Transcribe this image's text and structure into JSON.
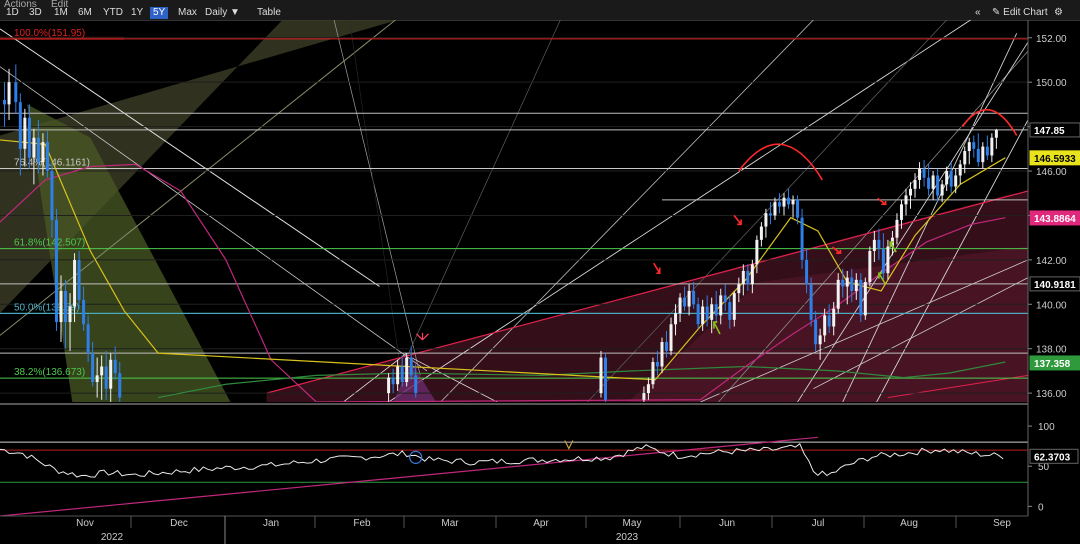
{
  "toolbar": {
    "menu_actions": "Actions",
    "menu_edit": "Edit",
    "ranges": [
      "1D",
      "3D",
      "1M",
      "6M",
      "YTD",
      "1Y",
      "5Y",
      "Max"
    ],
    "active_range": "5Y",
    "interval": "Daily",
    "interval_arrow": "▼",
    "table_label": "Table",
    "collapse_icon": "«",
    "edit_chart_label": "Edit Chart",
    "pencil_icon": "✎",
    "settings_icon": "⚙"
  },
  "colors": {
    "candle_up": "#f2f2f2",
    "candle_down": "#2f7fe8",
    "fib": "#4cc94c",
    "ma_fast": "#d8c21c",
    "ma_slow": "#c0287c",
    "ma_long": "#2f8a3c",
    "trend_channel": "#e0224c",
    "rsi": "#e8e8e8",
    "annot_red": "#ff2a2a",
    "annot_green": "#86c21c"
  },
  "chart_data": {
    "type": "candlestick",
    "months": [
      "Nov",
      "Dec",
      "Jan",
      "Feb",
      "Mar",
      "Apr",
      "May",
      "Jun",
      "Jul",
      "Aug",
      "Sep"
    ],
    "years": [
      "2022",
      "2023"
    ],
    "y_ticks": [
      136,
      138,
      140,
      142,
      144,
      146,
      148,
      150,
      152
    ],
    "y_range": [
      135.6,
      152.8
    ],
    "fib_levels": [
      {
        "label": "100.0%(151.95)",
        "value": 151.95
      },
      {
        "label": "76.4%(146.1161)",
        "value": 146.1161
      },
      {
        "label": "61.8%(142.507)",
        "value": 142.507
      },
      {
        "label": "50.0%(139.59)",
        "value": 139.59
      },
      {
        "label": "38.2%(136.673)",
        "value": 136.673
      }
    ],
    "horizontal_levels": [
      148.6,
      147.85,
      146.1161,
      144.7,
      140.9181,
      139.59,
      137.8
    ],
    "price_tags": [
      {
        "label": "147.85",
        "value": 147.85,
        "bg": "#000000",
        "fg": "#ffffff"
      },
      {
        "label": "146.5933",
        "value": 146.5933,
        "bg": "#e8e31c",
        "fg": "#000000"
      },
      {
        "label": "143.8864",
        "value": 143.8864,
        "bg": "#e0287c",
        "fg": "#ffffff"
      },
      {
        "label": "140.9181",
        "value": 140.9181,
        "bg": "#000000",
        "fg": "#ffffff"
      },
      {
        "label": "137.358",
        "value": 137.358,
        "bg": "#2f9a3c",
        "fg": "#ffffff"
      }
    ],
    "candles": [
      [
        0.2,
        149.2,
        150.0,
        148.0,
        149.0
      ],
      [
        0.4,
        149.0,
        150.6,
        148.3,
        150.0
      ],
      [
        0.7,
        150.0,
        150.8,
        148.6,
        149.1
      ],
      [
        0.9,
        149.1,
        149.5,
        145.8,
        147.0
      ],
      [
        1.1,
        147.0,
        148.8,
        146.2,
        148.4
      ],
      [
        1.3,
        148.4,
        149.0,
        146.1,
        146.6
      ],
      [
        1.5,
        146.6,
        147.9,
        145.4,
        147.5
      ],
      [
        1.7,
        147.5,
        148.3,
        145.9,
        146.4
      ],
      [
        1.9,
        146.4,
        147.7,
        145.8,
        147.3
      ],
      [
        2.1,
        147.3,
        147.8,
        145.7,
        146.0
      ],
      [
        2.3,
        146.0,
        146.4,
        143.0,
        143.8
      ],
      [
        2.5,
        143.8,
        144.3,
        138.8,
        139.2
      ],
      [
        2.7,
        139.2,
        141.3,
        138.3,
        140.6
      ],
      [
        2.9,
        140.6,
        141.1,
        138.0,
        139.2
      ],
      [
        3.1,
        139.2,
        140.5,
        137.9,
        139.9
      ],
      [
        3.3,
        139.9,
        142.3,
        139.2,
        142.0
      ],
      [
        3.5,
        142.0,
        142.4,
        139.8,
        140.2
      ],
      [
        3.7,
        140.2,
        140.8,
        138.8,
        139.1
      ],
      [
        3.9,
        139.1,
        139.5,
        137.4,
        137.8
      ],
      [
        4.1,
        137.8,
        138.3,
        136.3,
        136.5
      ],
      [
        4.3,
        136.5,
        137.6,
        135.8,
        136.8
      ],
      [
        4.5,
        136.8,
        137.7,
        135.7,
        137.2
      ],
      [
        4.7,
        137.2,
        137.9,
        135.7,
        136.2
      ],
      [
        4.9,
        136.2,
        137.8,
        135.6,
        137.5
      ],
      [
        5.1,
        137.5,
        138.1,
        136.6,
        136.9
      ],
      [
        5.3,
        136.9,
        137.4,
        135.6,
        135.8
      ],
      [
        17.2,
        136.0,
        136.9,
        135.6,
        136.7
      ],
      [
        17.4,
        136.7,
        137.1,
        136.0,
        136.4
      ],
      [
        17.6,
        136.4,
        137.5,
        136.1,
        137.2
      ],
      [
        17.8,
        137.2,
        137.7,
        136.3,
        136.5
      ],
      [
        18.0,
        136.5,
        137.8,
        136.3,
        137.6
      ],
      [
        18.2,
        137.6,
        138.1,
        136.6,
        136.8
      ],
      [
        18.4,
        136.8,
        137.3,
        135.8,
        136.0
      ],
      [
        26.6,
        136.0,
        137.9,
        135.8,
        137.6
      ],
      [
        26.8,
        137.6,
        137.8,
        135.6,
        135.7
      ],
      [
        28.5,
        135.7,
        136.3,
        135.6,
        136.0
      ],
      [
        28.7,
        136.0,
        136.7,
        135.7,
        136.4
      ],
      [
        28.9,
        136.4,
        137.6,
        136.2,
        137.4
      ],
      [
        29.1,
        137.4,
        137.9,
        136.8,
        137.2
      ],
      [
        29.3,
        137.2,
        138.5,
        136.9,
        138.3
      ],
      [
        29.5,
        138.3,
        138.8,
        137.6,
        137.9
      ],
      [
        29.7,
        137.9,
        139.4,
        137.7,
        139.1
      ],
      [
        29.9,
        139.1,
        140.0,
        138.6,
        139.6
      ],
      [
        30.1,
        139.6,
        140.5,
        139.2,
        140.3
      ],
      [
        30.3,
        140.3,
        140.8,
        139.7,
        139.9
      ],
      [
        30.5,
        139.9,
        140.9,
        139.5,
        140.6
      ],
      [
        30.7,
        140.6,
        141.0,
        139.8,
        140.0
      ],
      [
        30.9,
        140.0,
        140.3,
        138.9,
        139.1
      ],
      [
        31.1,
        139.1,
        140.2,
        138.8,
        139.9
      ],
      [
        31.3,
        139.9,
        140.4,
        139.0,
        139.3
      ],
      [
        31.5,
        139.3,
        140.3,
        138.7,
        140.0
      ],
      [
        31.7,
        140.0,
        140.6,
        139.2,
        139.5
      ],
      [
        31.9,
        139.5,
        140.7,
        139.1,
        140.4
      ],
      [
        32.1,
        140.4,
        140.9,
        139.7,
        140.1
      ],
      [
        32.3,
        140.1,
        140.4,
        138.9,
        139.3
      ],
      [
        32.5,
        139.3,
        140.6,
        139.0,
        140.5
      ],
      [
        32.7,
        140.5,
        141.2,
        140.1,
        140.9
      ],
      [
        32.9,
        140.9,
        141.8,
        140.4,
        141.5
      ],
      [
        33.1,
        141.5,
        141.8,
        140.6,
        140.9
      ],
      [
        33.3,
        140.9,
        142.0,
        140.5,
        141.8
      ],
      [
        33.5,
        141.8,
        143.1,
        141.4,
        142.9
      ],
      [
        33.7,
        142.9,
        143.7,
        142.6,
        143.5
      ],
      [
        33.9,
        143.5,
        144.3,
        143.0,
        144.1
      ],
      [
        34.1,
        144.1,
        144.6,
        143.6,
        144.0
      ],
      [
        34.3,
        144.0,
        144.8,
        143.8,
        144.6
      ],
      [
        34.5,
        144.6,
        145.0,
        144.1,
        144.4
      ],
      [
        34.7,
        144.4,
        145.0,
        144.0,
        144.8
      ],
      [
        34.9,
        144.8,
        145.2,
        144.3,
        144.5
      ],
      [
        35.1,
        144.5,
        144.9,
        143.9,
        144.7
      ],
      [
        35.3,
        144.7,
        144.9,
        143.6,
        143.9
      ],
      [
        35.5,
        143.9,
        144.3,
        141.6,
        142.0
      ],
      [
        35.7,
        142.0,
        142.5,
        140.5,
        140.9
      ],
      [
        35.9,
        140.9,
        141.2,
        139.0,
        139.3
      ],
      [
        36.1,
        139.3,
        139.7,
        137.9,
        138.2
      ],
      [
        36.3,
        138.2,
        138.9,
        137.5,
        138.6
      ],
      [
        36.5,
        138.6,
        139.8,
        138.3,
        139.5
      ],
      [
        36.7,
        139.5,
        140.0,
        138.7,
        139.0
      ],
      [
        36.9,
        139.0,
        140.1,
        138.6,
        139.8
      ],
      [
        37.1,
        139.8,
        141.4,
        139.6,
        141.1
      ],
      [
        37.3,
        141.1,
        141.6,
        140.3,
        140.8
      ],
      [
        37.5,
        140.8,
        141.5,
        140.0,
        141.2
      ],
      [
        37.7,
        141.2,
        141.6,
        140.1,
        140.6
      ],
      [
        37.9,
        140.6,
        141.4,
        140.2,
        141.1
      ],
      [
        38.1,
        141.1,
        141.4,
        139.2,
        139.5
      ],
      [
        38.3,
        139.5,
        141.2,
        139.3,
        141.0
      ],
      [
        38.5,
        141.0,
        142.6,
        140.8,
        142.4
      ],
      [
        38.7,
        142.4,
        143.3,
        141.9,
        142.9
      ],
      [
        38.9,
        142.9,
        143.4,
        142.0,
        142.5
      ],
      [
        39.1,
        142.5,
        143.2,
        141.1,
        141.4
      ],
      [
        39.3,
        141.4,
        142.9,
        141.1,
        142.6
      ],
      [
        39.5,
        142.6,
        143.3,
        142.2,
        143.0
      ],
      [
        39.7,
        143.0,
        144.1,
        142.7,
        143.8
      ],
      [
        39.9,
        143.8,
        144.7,
        143.4,
        144.5
      ],
      [
        40.1,
        144.5,
        145.2,
        144.0,
        144.9
      ],
      [
        40.3,
        144.9,
        145.5,
        144.3,
        145.2
      ],
      [
        40.5,
        145.2,
        145.9,
        144.8,
        145.6
      ],
      [
        40.7,
        145.6,
        146.4,
        145.2,
        146.1
      ],
      [
        40.9,
        146.1,
        146.5,
        145.3,
        145.7
      ],
      [
        41.1,
        145.7,
        146.3,
        144.9,
        145.2
      ],
      [
        41.3,
        145.2,
        146.0,
        144.7,
        145.8
      ],
      [
        41.5,
        145.8,
        146.1,
        144.6,
        144.9
      ],
      [
        41.7,
        144.9,
        145.6,
        144.6,
        145.4
      ],
      [
        41.9,
        145.4,
        146.2,
        145.1,
        146.0
      ],
      [
        42.1,
        146.0,
        146.4,
        145.0,
        145.3
      ],
      [
        42.3,
        145.3,
        146.1,
        145.0,
        145.8
      ],
      [
        42.5,
        145.8,
        146.5,
        145.4,
        146.3
      ],
      [
        42.7,
        146.3,
        147.1,
        145.9,
        146.9
      ],
      [
        42.9,
        146.9,
        147.5,
        146.3,
        147.3
      ],
      [
        43.1,
        147.3,
        147.6,
        146.6,
        147.0
      ],
      [
        43.3,
        147.0,
        147.7,
        146.2,
        146.4
      ],
      [
        43.5,
        146.4,
        147.3,
        146.1,
        147.1
      ],
      [
        43.7,
        147.1,
        147.6,
        146.5,
        146.7
      ],
      [
        43.9,
        146.7,
        147.7,
        146.4,
        147.5
      ],
      [
        44.1,
        147.5,
        147.9,
        147.0,
        147.85
      ]
    ],
    "ma_fast": [
      [
        0,
        147.4
      ],
      [
        2,
        147.2
      ],
      [
        4.0,
        142.4
      ],
      [
        5.5,
        139.7
      ],
      [
        7,
        137.8
      ],
      [
        29,
        136.6
      ],
      [
        31,
        139.0
      ],
      [
        33,
        141.1
      ],
      [
        35,
        143.9
      ],
      [
        36.2,
        143.3
      ],
      [
        37.5,
        141.0
      ],
      [
        39,
        140.6
      ],
      [
        40.5,
        143.1
      ],
      [
        42.5,
        145.4
      ],
      [
        44.5,
        146.6
      ]
    ],
    "ma_slow": [
      [
        0,
        143.7
      ],
      [
        2,
        145.6
      ],
      [
        4,
        146.2
      ],
      [
        6,
        146.3
      ],
      [
        8,
        145.1
      ],
      [
        10,
        142.0
      ],
      [
        12,
        137.5
      ],
      [
        14,
        135.6
      ],
      [
        31,
        135.7
      ],
      [
        33,
        137.2
      ],
      [
        35,
        138.6
      ],
      [
        37,
        139.9
      ],
      [
        39,
        141.4
      ],
      [
        41,
        142.8
      ],
      [
        43,
        143.6
      ],
      [
        44.5,
        143.9
      ]
    ],
    "ma_long": [
      [
        7,
        135.8
      ],
      [
        10,
        136.4
      ],
      [
        14,
        136.8
      ],
      [
        18,
        136.9
      ],
      [
        24,
        136.8
      ],
      [
        28,
        137.0
      ],
      [
        33,
        137.2
      ],
      [
        37,
        137.0
      ],
      [
        40,
        136.7
      ],
      [
        42,
        136.9
      ],
      [
        44.5,
        137.4
      ]
    ],
    "rsi": {
      "current_label": "62.3703",
      "current": 62.37,
      "y_ticks": [
        0,
        50,
        100
      ],
      "y_range": [
        -12,
        125
      ],
      "levels": [
        70,
        30
      ]
    }
  }
}
